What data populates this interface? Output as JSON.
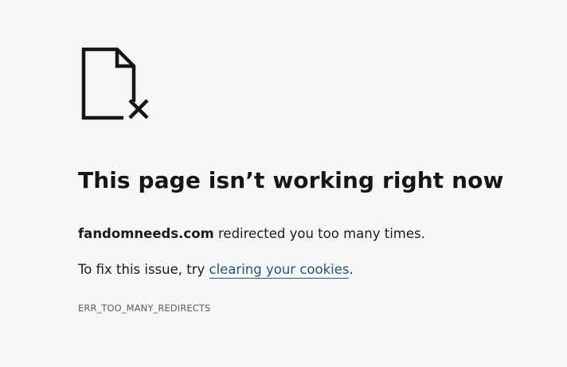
{
  "icon": "broken-page-icon",
  "colors": {
    "background": "#f7f7f7",
    "text": "#1b1b1b",
    "link": "#1a5a7a",
    "error_code": "#5c5c5c"
  },
  "error": {
    "heading": "This page isn’t working right now",
    "domain": "fandomneeds.com",
    "redirect_message": " redirected you too many times.",
    "fix_prefix": "To fix this issue, try ",
    "fix_link": "clearing your cookies",
    "fix_suffix": ".",
    "code": "ERR_TOO_MANY_REDIRECTS"
  }
}
